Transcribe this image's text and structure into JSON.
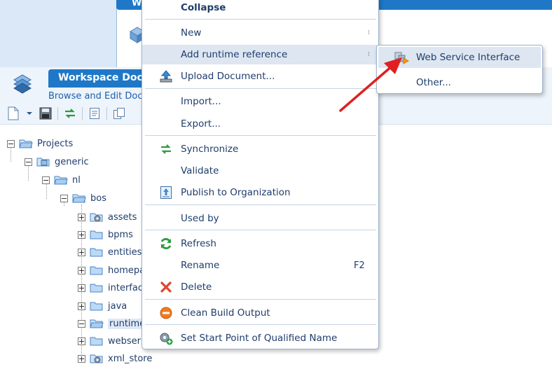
{
  "background_window": {
    "title": "W"
  },
  "workspace": {
    "title": "Workspace Doc",
    "subtitle": "Browse and Edit Docu"
  },
  "tree": {
    "items": [
      {
        "label": "Projects",
        "level": 0,
        "expanded": true
      },
      {
        "label": "generic",
        "level": 1,
        "expanded": true
      },
      {
        "label": "nl",
        "level": 2,
        "expanded": true
      },
      {
        "label": "bos",
        "level": 3,
        "expanded": true
      },
      {
        "label": "assets",
        "level": 4,
        "expanded": false
      },
      {
        "label": "bpms",
        "level": 4,
        "expanded": false
      },
      {
        "label": "entities",
        "level": 4,
        "expanded": false
      },
      {
        "label": "homepa",
        "level": 4,
        "expanded": false
      },
      {
        "label": "interfac",
        "level": 4,
        "expanded": false
      },
      {
        "label": "java",
        "level": 4,
        "expanded": false
      },
      {
        "label": "runtime",
        "level": 4,
        "expanded": true,
        "selected": true
      },
      {
        "label": "webser",
        "level": 4,
        "expanded": false
      },
      {
        "label": "xml_store",
        "level": 4,
        "expanded": false
      }
    ]
  },
  "context_menu": {
    "items": {
      "collapse": "Collapse",
      "new": "New",
      "add_runtime_reference": "Add runtime reference",
      "upload_document": "Upload Document...",
      "import": "Import...",
      "export": "Export...",
      "synchronize": "Synchronize",
      "validate": "Validate",
      "publish": "Publish to Organization",
      "used_by": "Used by",
      "refresh": "Refresh",
      "rename": "Rename",
      "rename_shortcut": "F2",
      "delete": "Delete",
      "clean_build_output": "Clean Build Output",
      "set_start_point": "Set Start Point of Qualified Name"
    }
  },
  "submenu": {
    "web_service_interface": "Web Service Interface",
    "other": "Other..."
  },
  "colors": {
    "accent": "#1e78c7",
    "menu_highlight": "#dde6f1",
    "annotation_arrow": "#e02020"
  }
}
